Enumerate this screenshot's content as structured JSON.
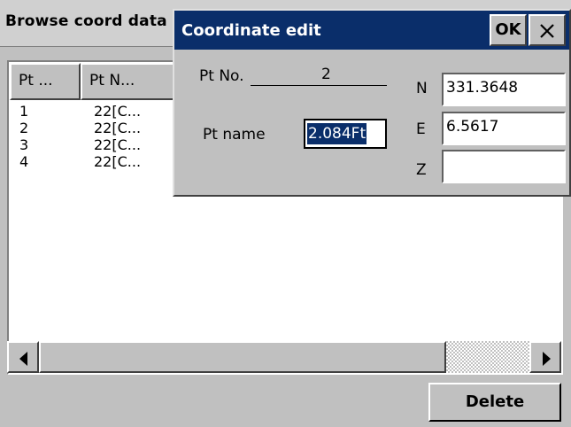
{
  "window": {
    "title": "Browse coord data"
  },
  "list": {
    "columns": [
      "Pt ...",
      "Pt N..."
    ],
    "rows": [
      {
        "pt": "1",
        "name": "22[C..."
      },
      {
        "pt": "2",
        "name": "22[C..."
      },
      {
        "pt": "3",
        "name": "22[C..."
      },
      {
        "pt": "4",
        "name": "22[C..."
      }
    ]
  },
  "actions": {
    "delete_label": "Delete"
  },
  "dialog": {
    "title": "Coordinate edit",
    "ok_label": "OK",
    "pt_no_label": "Pt No.",
    "pt_no_value": "2",
    "pt_name_label": "Pt name",
    "pt_name_value": "2.084Ft",
    "n_label": "N",
    "n_value": "331.3648",
    "e_label": "E",
    "e_value": "6.5617",
    "z_label": "Z",
    "z_value": ""
  },
  "colors": {
    "dialog_title_bg": "#0a2e6a",
    "background": "#c0c0c0"
  }
}
